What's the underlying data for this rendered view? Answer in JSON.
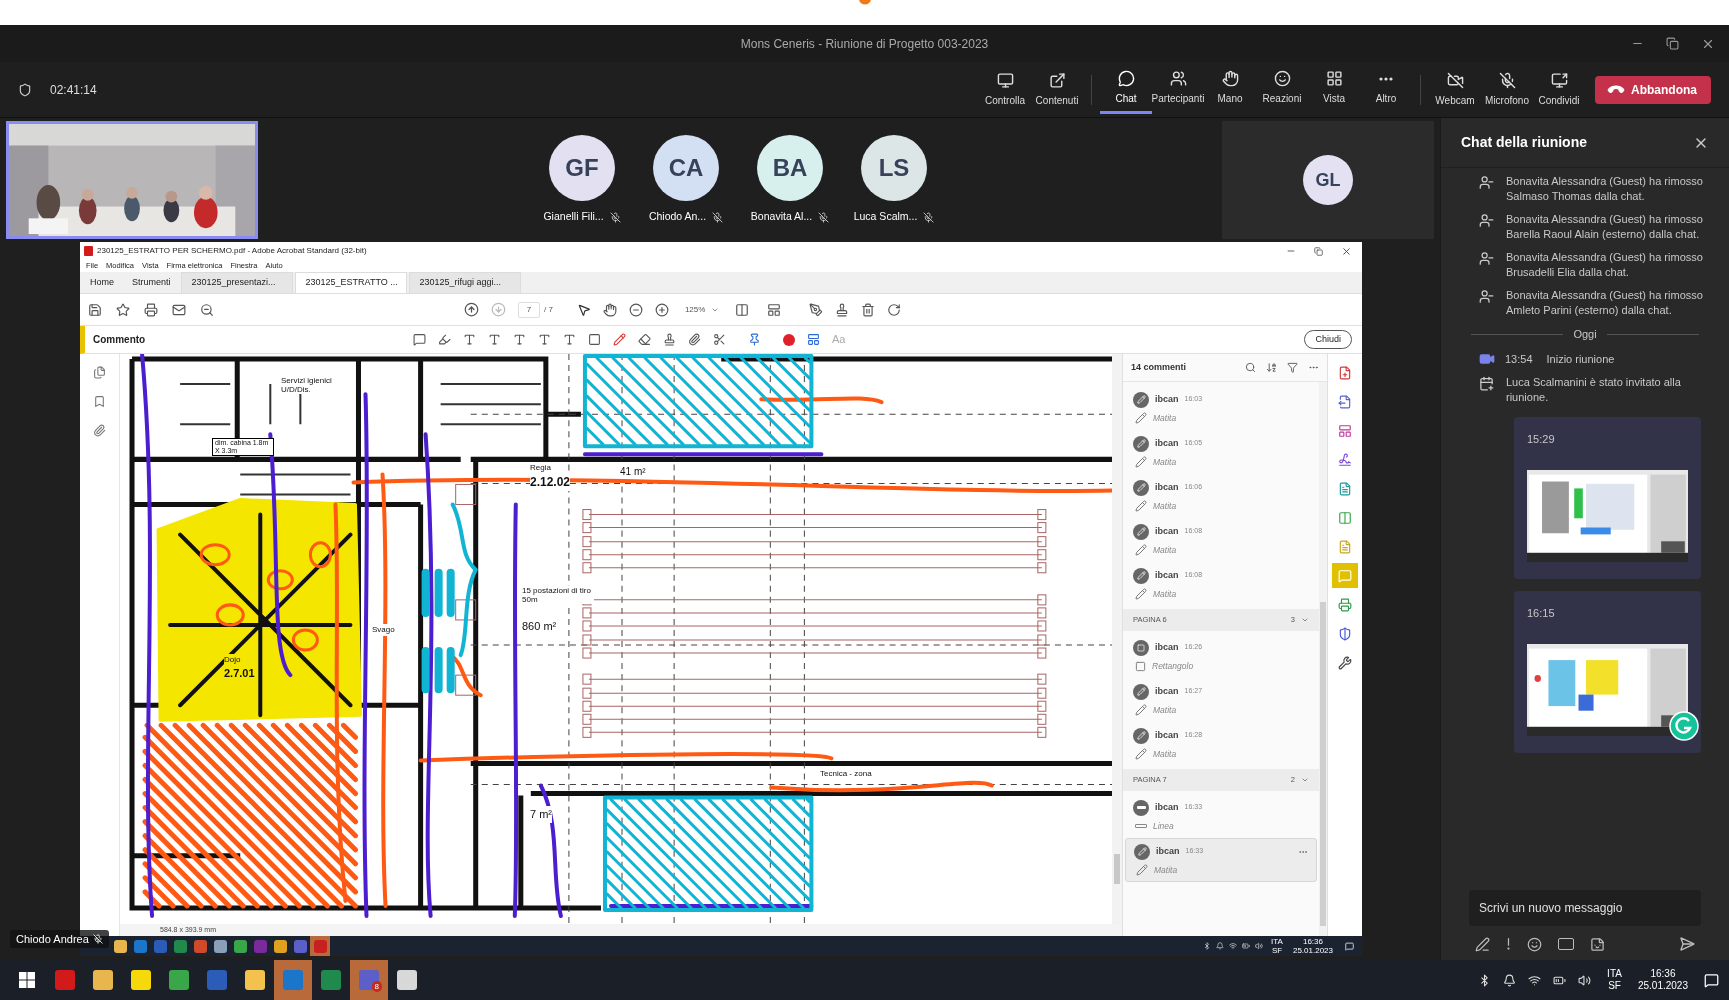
{
  "window": {
    "title": "Mons Ceneris - Riunione di Progetto 003-2023"
  },
  "meeting_bar": {
    "timer": "02:41:14",
    "control_buttons": [
      "Controlla",
      "Contenuti"
    ],
    "view_buttons": [
      {
        "label": "Chat",
        "selected": true
      },
      {
        "label": "Partecipanti",
        "selected": false
      },
      {
        "label": "Mano",
        "selected": false
      },
      {
        "label": "Reazioni",
        "selected": false
      },
      {
        "label": "Vista",
        "selected": false
      },
      {
        "label": "Altro",
        "selected": false
      }
    ],
    "media_buttons": [
      {
        "label": "Webcam",
        "off": true
      },
      {
        "label": "Microfono",
        "off": true
      }
    ],
    "share": "Condividi",
    "leave": "Abbandona"
  },
  "participants": [
    {
      "initials": "GF",
      "name": "Gianelli Fili...",
      "color": "#e3e0f2",
      "muted": true
    },
    {
      "initials": "CA",
      "name": "Chiodo An...",
      "color": "#d3e0f3",
      "muted": true
    },
    {
      "initials": "BA",
      "name": "Bonavita Al...",
      "color": "#d7f0ee",
      "muted": true
    },
    {
      "initials": "LS",
      "name": "Luca Scalm...",
      "color": "#dde6e6",
      "muted": true
    }
  ],
  "side_tile": {
    "initials": "GL",
    "color": "#e4e1f3"
  },
  "presenter_label": {
    "name": "Chiodo Andrea",
    "muted": true
  },
  "acrobat": {
    "title": "230125_ESTRATTO PER SCHERMO.pdf - Adobe Acrobat Standard (32-bit)",
    "menu": [
      "File",
      "Modifica",
      "Vista",
      "Firma elettronica",
      "Finestra",
      "Aiuto"
    ],
    "tabs": [
      {
        "label": "Home",
        "kind": "nav",
        "selected": false
      },
      {
        "label": "Strumenti",
        "kind": "nav",
        "selected": false
      },
      {
        "label": "230125_presentazi...",
        "kind": "document",
        "selected": false
      },
      {
        "label": "230125_ESTRATTO ...",
        "kind": "document",
        "selected": true
      },
      {
        "label": "230125_rifugi aggi...",
        "kind": "document",
        "selected": false
      }
    ],
    "page": "7",
    "page_total": "/ 7",
    "zoom": "125%",
    "comment_bar": {
      "title": "Commento",
      "text_tool": "Aa",
      "close": "Chiudi"
    },
    "plan_labels": [
      "Servizi igienici U/D/Dis.",
      "dim. cabina 1.8m X 3.3m",
      "Regia",
      "2.12.02",
      "41 m²",
      "15 postazioni di tiro 50m",
      "860 m²",
      "Dojo",
      "2.7.01",
      "Svago",
      "Tecnica - zona",
      "7 m²"
    ],
    "dimensions": "584.8 x 393.9 mm",
    "comments": {
      "count": "14 commenti",
      "items": [
        {
          "kind": "pencil",
          "author": "ibcan",
          "time": "16:03",
          "type": "Matita",
          "selected": false
        },
        {
          "kind": "pencil",
          "author": "ibcan",
          "time": "16:05",
          "type": "Matita",
          "selected": false
        },
        {
          "kind": "pencil",
          "author": "ibcan",
          "time": "16:06",
          "type": "Matita",
          "selected": false
        },
        {
          "kind": "pencil",
          "author": "ibcan",
          "time": "16:08",
          "type": "Matita",
          "selected": false
        },
        {
          "kind": "pencil",
          "author": "ibcan",
          "time": "16:08",
          "type": "Matita",
          "selected": false
        },
        {
          "kind": "page",
          "label": "PAGINA 6",
          "count": "3"
        },
        {
          "kind": "rectangle",
          "author": "ibcan",
          "time": "16:26",
          "type": "Rettangolo",
          "selected": false
        },
        {
          "kind": "pencil",
          "author": "ibcan",
          "time": "16:27",
          "type": "Matita",
          "selected": false
        },
        {
          "kind": "pencil",
          "author": "ibcan",
          "time": "16:28",
          "type": "Matita",
          "selected": false
        },
        {
          "kind": "page",
          "label": "PAGINA 7",
          "count": "2"
        },
        {
          "kind": "line",
          "author": "ibcan",
          "time": "16:33",
          "type": "Linea",
          "selected": false
        },
        {
          "kind": "pencil",
          "author": "ibcan",
          "time": "16:33",
          "type": "Matita",
          "selected": true
        }
      ]
    },
    "tools_rail": [
      {
        "selected": false
      },
      {
        "selected": false
      },
      {
        "selected": false
      },
      {
        "selected": false
      },
      {
        "selected": false
      },
      {
        "selected": false
      },
      {
        "selected": false
      },
      {
        "selected": true
      },
      {
        "selected": false
      },
      {
        "selected": false
      },
      {
        "selected": false
      }
    ]
  },
  "remote_taskbar": {
    "apps": [
      {
        "color": "#e8b64c",
        "active": false
      },
      {
        "color": "#1b76c9",
        "active": false
      },
      {
        "color": "#2b5cb8",
        "active": false
      },
      {
        "color": "#1f8a4c",
        "active": false
      },
      {
        "color": "#d04a2a",
        "active": false
      },
      {
        "color": "#8aa0b8",
        "active": false
      },
      {
        "color": "#3aa64a",
        "active": false
      },
      {
        "color": "#7a2a9a",
        "active": false
      },
      {
        "color": "#e0a020",
        "active": false
      },
      {
        "color": "#5b5fc7",
        "active": false
      },
      {
        "color": "#c8201e",
        "active": true
      }
    ],
    "lang": [
      "ITA",
      "SF"
    ],
    "time": "16:36",
    "date": "25.01.2023"
  },
  "taskbar": {
    "apps": [
      {
        "color": "#d21a1a",
        "active": false
      },
      {
        "color": "#e8b64c",
        "active": false
      },
      {
        "color": "#f5d90a",
        "active": false
      },
      {
        "color": "#3aa64a",
        "active": false
      },
      {
        "color": "#2b5cb8",
        "active": false
      },
      {
        "color": "#f2c14e",
        "active": false
      },
      {
        "color": "#1b76c9",
        "active": true
      },
      {
        "color": "#1f8a4c",
        "active": false
      },
      {
        "color": "#5b5fc7",
        "active": true,
        "badge": "8"
      },
      {
        "color": "#d8d8d8",
        "active": false
      }
    ],
    "lang": [
      "ITA",
      "SF"
    ],
    "time": "16:36",
    "date": "25.01.2023"
  },
  "chat": {
    "title": "Chat della riunione",
    "messages": [
      {
        "kind": "removed",
        "text": "Bonavita Alessandra (Guest) ha rimosso Salmaso Thomas dalla chat."
      },
      {
        "kind": "removed",
        "text": "Bonavita Alessandra (Guest) ha rimosso Barella Raoul Alain (esterno) dalla chat."
      },
      {
        "kind": "removed",
        "text": "Bonavita Alessandra (Guest) ha rimosso Brusadelli Elia dalla chat."
      },
      {
        "kind": "removed",
        "text": "Bonavita Alessandra (Guest) ha rimosso Amleto Parini (esterno) dalla chat."
      },
      {
        "kind": "divider",
        "text": "Oggi"
      },
      {
        "kind": "meeting",
        "time": "13:54",
        "text": "Inizio riunione"
      },
      {
        "kind": "invited",
        "text": "Luca Scalmanini è stato invitato alla riunione."
      },
      {
        "time": "15:29"
      },
      {
        "time": "16:15"
      }
    ],
    "compose": {
      "placeholder": "Scrivi un nuovo messaggio"
    }
  }
}
